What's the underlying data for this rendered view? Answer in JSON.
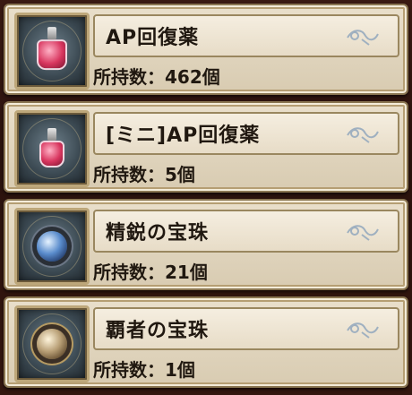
{
  "items": [
    {
      "name": "AP回復薬",
      "count": "所持数：462個",
      "icon": "potion-icon"
    },
    {
      "name": "[ミニ]AP回復薬",
      "count": "所持数：5個",
      "icon": "mini-potion-icon"
    },
    {
      "name": "精鋭の宝珠",
      "count": "所持数：21個",
      "icon": "blue-orb-icon"
    },
    {
      "name": "覇者の宝珠",
      "count": "所持数：1個",
      "icon": "gold-orb-icon"
    }
  ],
  "colors": {
    "panel": "#e3d7bf",
    "text": "#201810",
    "background": "#2a120d",
    "potion": "#d8365f",
    "orb_blue": "#5a8ccc",
    "orb_gold": "#b89f76"
  }
}
